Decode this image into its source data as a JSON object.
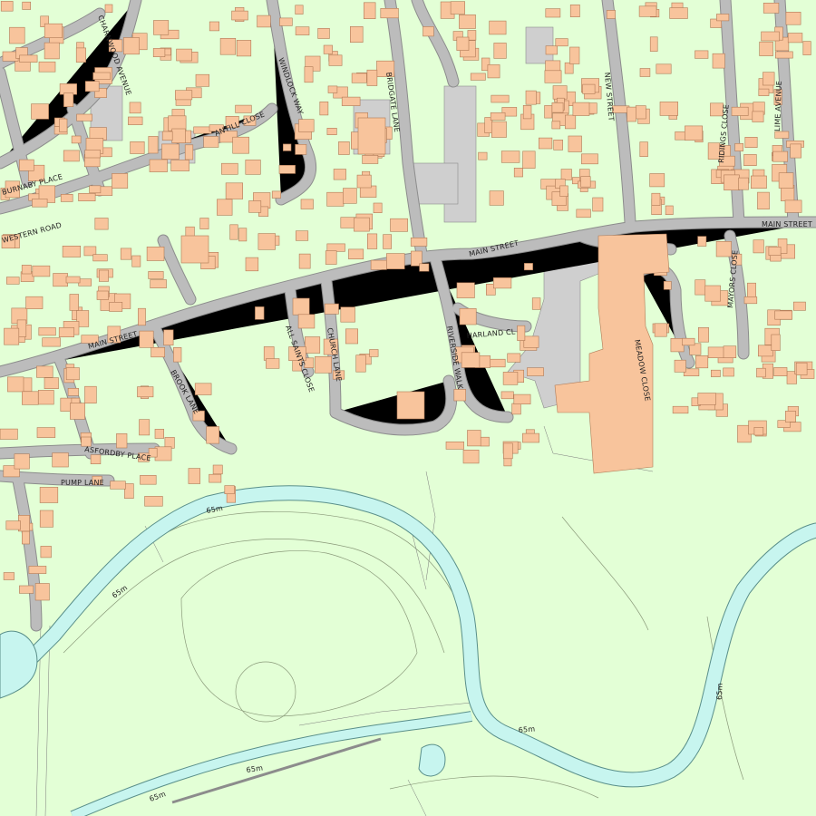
{
  "map": {
    "street_labels": [
      {
        "id": "charnwood-avenue",
        "text": "CHARNWOOD AVENUE"
      },
      {
        "id": "windlock-way",
        "text": "WINDLOCK WAY"
      },
      {
        "id": "bridgate-lane",
        "text": "BRIDGATE LANE"
      },
      {
        "id": "new-street",
        "text": "NEW STREET"
      },
      {
        "id": "ridings-close",
        "text": "RIDINGS CLOSE"
      },
      {
        "id": "lime-avenue",
        "text": "LIME AVENUE"
      },
      {
        "id": "antill-close",
        "text": "ANTILL CLOSE"
      },
      {
        "id": "burnaby-place",
        "text": "BURNABY PLACE"
      },
      {
        "id": "western-road",
        "text": "WESTERN ROAD"
      },
      {
        "id": "main-street-east",
        "text": "MAIN STREET"
      },
      {
        "id": "main-street-centre",
        "text": "MAIN STREET"
      },
      {
        "id": "main-street-west",
        "text": "MAIN STREET"
      },
      {
        "id": "mayors-close",
        "text": "MAYORS CLOSE"
      },
      {
        "id": "harland-cl",
        "text": "HARLAND CL"
      },
      {
        "id": "riverside-walk",
        "text": "RIVERSIDE WALK"
      },
      {
        "id": "meadow-close",
        "text": "MEADOW CLOSE"
      },
      {
        "id": "church-lane",
        "text": "CHURCH LANE"
      },
      {
        "id": "all-saints-close",
        "text": "ALL SAINTS CLOSE"
      },
      {
        "id": "brook-lane",
        "text": "BROOK LANE"
      },
      {
        "id": "asfordby-place",
        "text": "ASFORDBY PLACE"
      },
      {
        "id": "pump-lane",
        "text": "PUMP LANE"
      }
    ],
    "contour_labels": [
      {
        "id": "c1",
        "text": "65m"
      },
      {
        "id": "c2",
        "text": "65m"
      },
      {
        "id": "c3",
        "text": "65m"
      },
      {
        "id": "c4",
        "text": "65m"
      },
      {
        "id": "c5",
        "text": "65m"
      },
      {
        "id": "c6",
        "text": "65m"
      }
    ],
    "colors": {
      "land": "#e3ffd6",
      "building": "#f8c49c",
      "road": "#bcbcbc",
      "water": "#c7f5ef",
      "water_edge": "#5a8f8a",
      "contour": "#8a9a7a"
    }
  }
}
